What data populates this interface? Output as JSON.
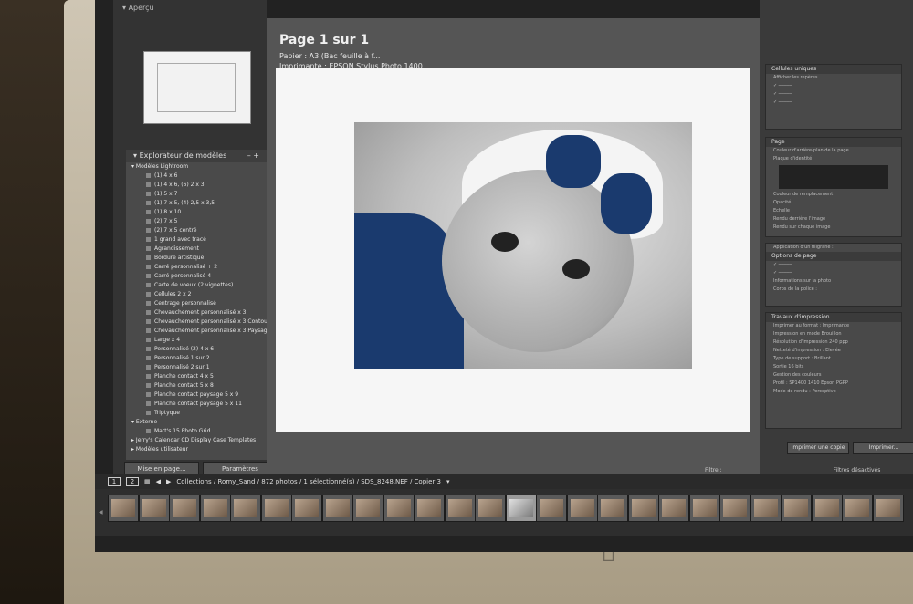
{
  "left_panel": {
    "preview_title": "Aperçu",
    "explorer_title": "Explorateur de modèles",
    "explorer_controls": {
      "remove": "–",
      "add": "+"
    },
    "folder_lightroom": "Modèles Lightroom",
    "templates": [
      "(1) 4 x 6",
      "(1) 4 x 6, (6) 2 x 3",
      "(1) 5 x 7",
      "(1) 7 x 5, (4) 2,5 x 3,5",
      "(1) 8 x 10",
      "(2) 7 x 5",
      "(2) 7 x 5 centré",
      "1 grand avec tracé",
      "Agrandissement",
      "Bordure artistique",
      "Carré personnalisé + 2",
      "Carré personnalisé 4",
      "Carte de voeux (2 vignettes)",
      "Cellules 2 x 2",
      "Centrage personnalisé",
      "Chevauchement personnalisé x 3",
      "Chevauchement personnalisé x 3 Contour",
      "Chevauchement personnalisé x 3 Paysage",
      "Large x 4",
      "Personnalisé (2) 4 x 6",
      "Personnalisé 1 sur 2",
      "Personnalisé 2 sur 1",
      "Planche contact 4 x 5",
      "Planche contact 5 x 8",
      "Planche contact paysage 5 x 9",
      "Planche contact paysage 5 x 11",
      "Triptyque"
    ],
    "folder_external": "Externe",
    "external_items": [
      "Matt's 15 Photo Grid"
    ],
    "folder_jerry": "Jerry's Calendar CD Display Case Templates",
    "folder_user": "Modèles utilisateur",
    "btn_page_setup": "Mise en page...",
    "btn_print_settings": "Paramètres d'impression..."
  },
  "center": {
    "page_title": "Page 1 sur 1",
    "paper": "Papier : A3 (Bac feuille à f...",
    "printer": "Imprimante : EPSON Stylus Photo 1400"
  },
  "right_panel": {
    "top_label": "Cellules uniques",
    "section_guides": "Afficher les repères",
    "page_label": "Page",
    "section_bg": "Couleur d'arrière-plan de la page",
    "identity": "Plaque d'identité",
    "overlay_color": "Couleur de remplacement",
    "opacity": "Opacité",
    "scale": "Echelle",
    "render_behind": "Rendu derrière l'image",
    "render_each": "Rendu sur chaque image",
    "apply_watermark": "Application d'un filigrane :",
    "page_options": "Options de page",
    "photo_info": "Informations sur la photo",
    "font_size": "Corps de la police :",
    "print_job": "Travaux d'impression",
    "print_to": "Imprimer au format :",
    "print_to_value": "Imprimante",
    "draft_mode": "Impression en mode Brouillon",
    "resolution": "Résolution d'impression",
    "resolution_value": "240 ppp",
    "sharpen": "Netteté d'impression :",
    "sharpen_value": "Elevée",
    "media_type": "Type de support :",
    "media_value": "Brillant",
    "output_16": "Sortie 16 bits",
    "color_mgmt": "Gestion des couleurs",
    "profile": "Profil :",
    "profile_value": "SP1400 1410 Epson PGPP",
    "intent": "Mode de rendu :",
    "intent_value": "Perceptive",
    "btn_print_one": "Imprimer une copie",
    "btn_print": "Imprimer..."
  },
  "filmstrip": {
    "view1": "1",
    "view2": "2",
    "path": "Collections / Romy_Sand / 872 photos / 1 sélectionné(s) / SDS_8248.NEF / Copier 3",
    "filter": "Filtre :",
    "filter_state": "Filtres désactivés",
    "thumb_count": 26,
    "selected_index": 13
  }
}
